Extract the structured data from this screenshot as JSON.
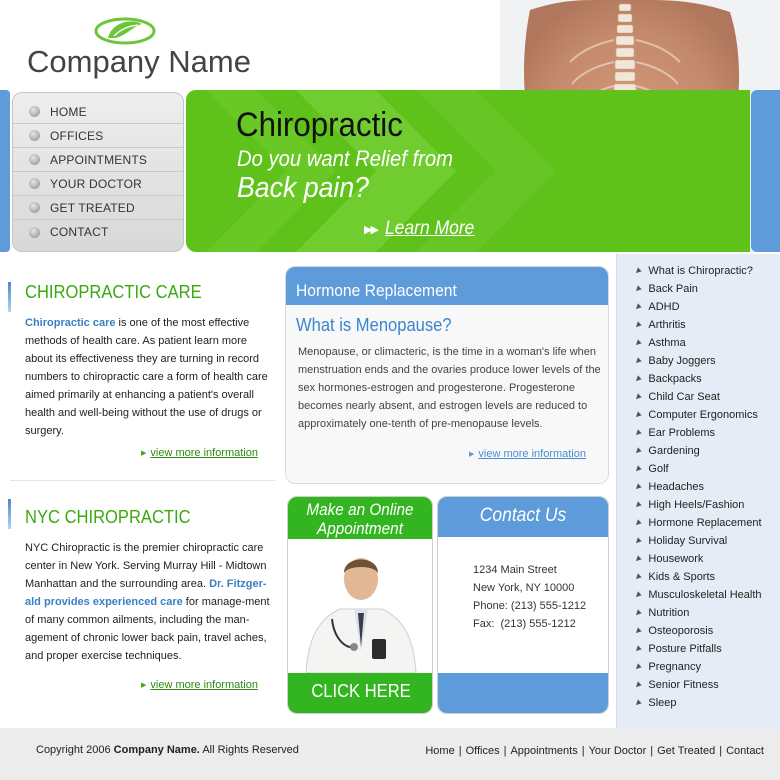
{
  "brand": {
    "company_name": "Company Name",
    "green": "#5ec21a",
    "blue": "#5d9bdb",
    "logo_icon": "leaf-logo-icon"
  },
  "nav": {
    "items": [
      {
        "label": "HOME"
      },
      {
        "label": "OFFICES"
      },
      {
        "label": "APPOINTMENTS"
      },
      {
        "label": "YOUR DOCTOR"
      },
      {
        "label": "GET TREATED"
      },
      {
        "label": "CONTACT"
      }
    ]
  },
  "banner": {
    "title": "Chiropractic",
    "subtitle_line1": "Do you want Relief from",
    "subtitle_line2": "Back pain?",
    "learn_more_arrow": "▶▶",
    "learn_more": "Learn More",
    "photo_icon": "spine-back-photo"
  },
  "care": {
    "title": "CHIROPRACTIC CARE",
    "highlight": "Chiropractic care",
    "body": " is one of the most effective methods of health care. As patient learn more about its effectiveness they are turning in record numbers to chiropractic care a form of health care aimed primarily at enhancing a patient's overall health and well-being without the use of drugs or surgery.",
    "view_more": "view more information"
  },
  "nyc": {
    "title": "NYC CHIROPRACTIC",
    "body_before": "NYC Chiropractic is the premier chiropractic care center in New York. Serving Murray Hill - Midtown Manhattan and the surrounding area. ",
    "highlight": "Dr. Fitzger-ald provides experienced care",
    "body_after": " for manage-ment of many common ailments, including the man-agement of chronic lower back pain, travel aches, and proper exercise techniques.",
    "view_more": "view more information"
  },
  "hormone": {
    "header": "Hormone Replacement",
    "question": "What is Menopause?",
    "body": "Menopause, or climacteric, is the time in a woman's life when menstruation ends and the ovaries produce lower levels of the sex hormones-estrogen and progesterone. Progesterone becomes nearly absent, and estrogen levels are reduced to approximately one-tenth of pre-menopause levels.",
    "view_more": "view more information"
  },
  "appointment": {
    "line1": "Make an Online",
    "line2": "Appointment",
    "cta": "CLICK HERE",
    "photo_icon": "doctor-photo"
  },
  "contact": {
    "header": "Contact Us",
    "address1": "1234 Main Street",
    "address2": "New York, NY 10000",
    "phone": "Phone: (213) 555-1212",
    "fax": "Fax:  (213) 555-1212"
  },
  "topics": [
    "What is Chiropractic?",
    "Back Pain",
    "ADHD",
    "Arthritis",
    "Asthma",
    "Baby Joggers",
    "Backpacks",
    "Child Car Seat",
    "Computer Ergonomics",
    "Ear Problems",
    "Gardening",
    "Golf",
    "Headaches",
    "High Heels/Fashion",
    "Hormone Replacement",
    "Holiday Survival",
    "Housework",
    "Kids & Sports",
    "Musculoskeletal Health",
    "Nutrition",
    "Osteoporosis",
    "Posture Pitfalls",
    "Pregnancy",
    "Senior Fitness",
    "Sleep"
  ],
  "footer": {
    "copyright_prefix": "Copyright 2006 ",
    "copyright_name": "Company Name.",
    "copyright_suffix": " All Rights Reserved",
    "separator": "|",
    "links": [
      "Home",
      "Offices",
      "Appointments",
      "Your Doctor",
      "Get Treated",
      "Contact"
    ]
  }
}
